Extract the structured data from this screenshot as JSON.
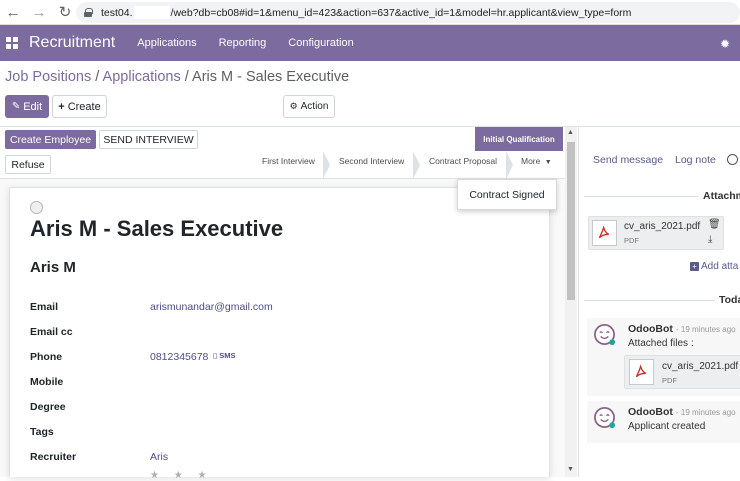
{
  "browser": {
    "url_prefix": "test04.",
    "url_rest": "/web?db=cb08#id=1&menu_id=423&action=637&active_id=1&model=hr.applicant&view_type=form"
  },
  "navbar": {
    "brand": "Recruitment",
    "menus": [
      "Applications",
      "Reporting",
      "Configuration"
    ],
    "accent_color": "#7c6b9e"
  },
  "breadcrumb": {
    "items": [
      "Job Positions",
      "Applications",
      "Aris M - Sales Executive"
    ]
  },
  "control": {
    "edit": "Edit",
    "create": "Create",
    "action": "Action"
  },
  "statusbar": {
    "create_employee": "Create Employee",
    "send_interview": "SEND INTERVIEW",
    "refuse": "Refuse",
    "active_stage": "Initial Qualification",
    "stages": [
      "First Interview",
      "Second Interview",
      "Contract Proposal"
    ],
    "more": "More",
    "dropdown_item": "Contract Signed"
  },
  "form": {
    "title": "Aris M - Sales Executive",
    "applicant_name": "Aris M",
    "fields": {
      "email_label": "Email",
      "email_value": "arismunandar@gmail.com",
      "email_cc_label": "Email cc",
      "phone_label": "Phone",
      "phone_value": "0812345678",
      "sms_label": "SMS",
      "mobile_label": "Mobile",
      "degree_label": "Degree",
      "tags_label": "Tags",
      "recruiter_label": "Recruiter",
      "recruiter_value": "Aris"
    },
    "stars": "★ ★ ★"
  },
  "chatter": {
    "send_message": "Send message",
    "log_note": "Log note",
    "attachments_title": "Attachm",
    "attachment": {
      "name": "cv_aris_2021.pdf",
      "ext": "PDF"
    },
    "add_attachment": "Add atta",
    "today_title": "Toda",
    "messages": [
      {
        "author": "OdooBot",
        "time": "- 19 minutes ago",
        "text": "Attached files :",
        "file_name": "cv_aris_2021.pdf",
        "file_ext": "PDF"
      },
      {
        "author": "OdooBot",
        "time": "- 19 minutes ago",
        "text": "Applicant created"
      }
    ]
  }
}
